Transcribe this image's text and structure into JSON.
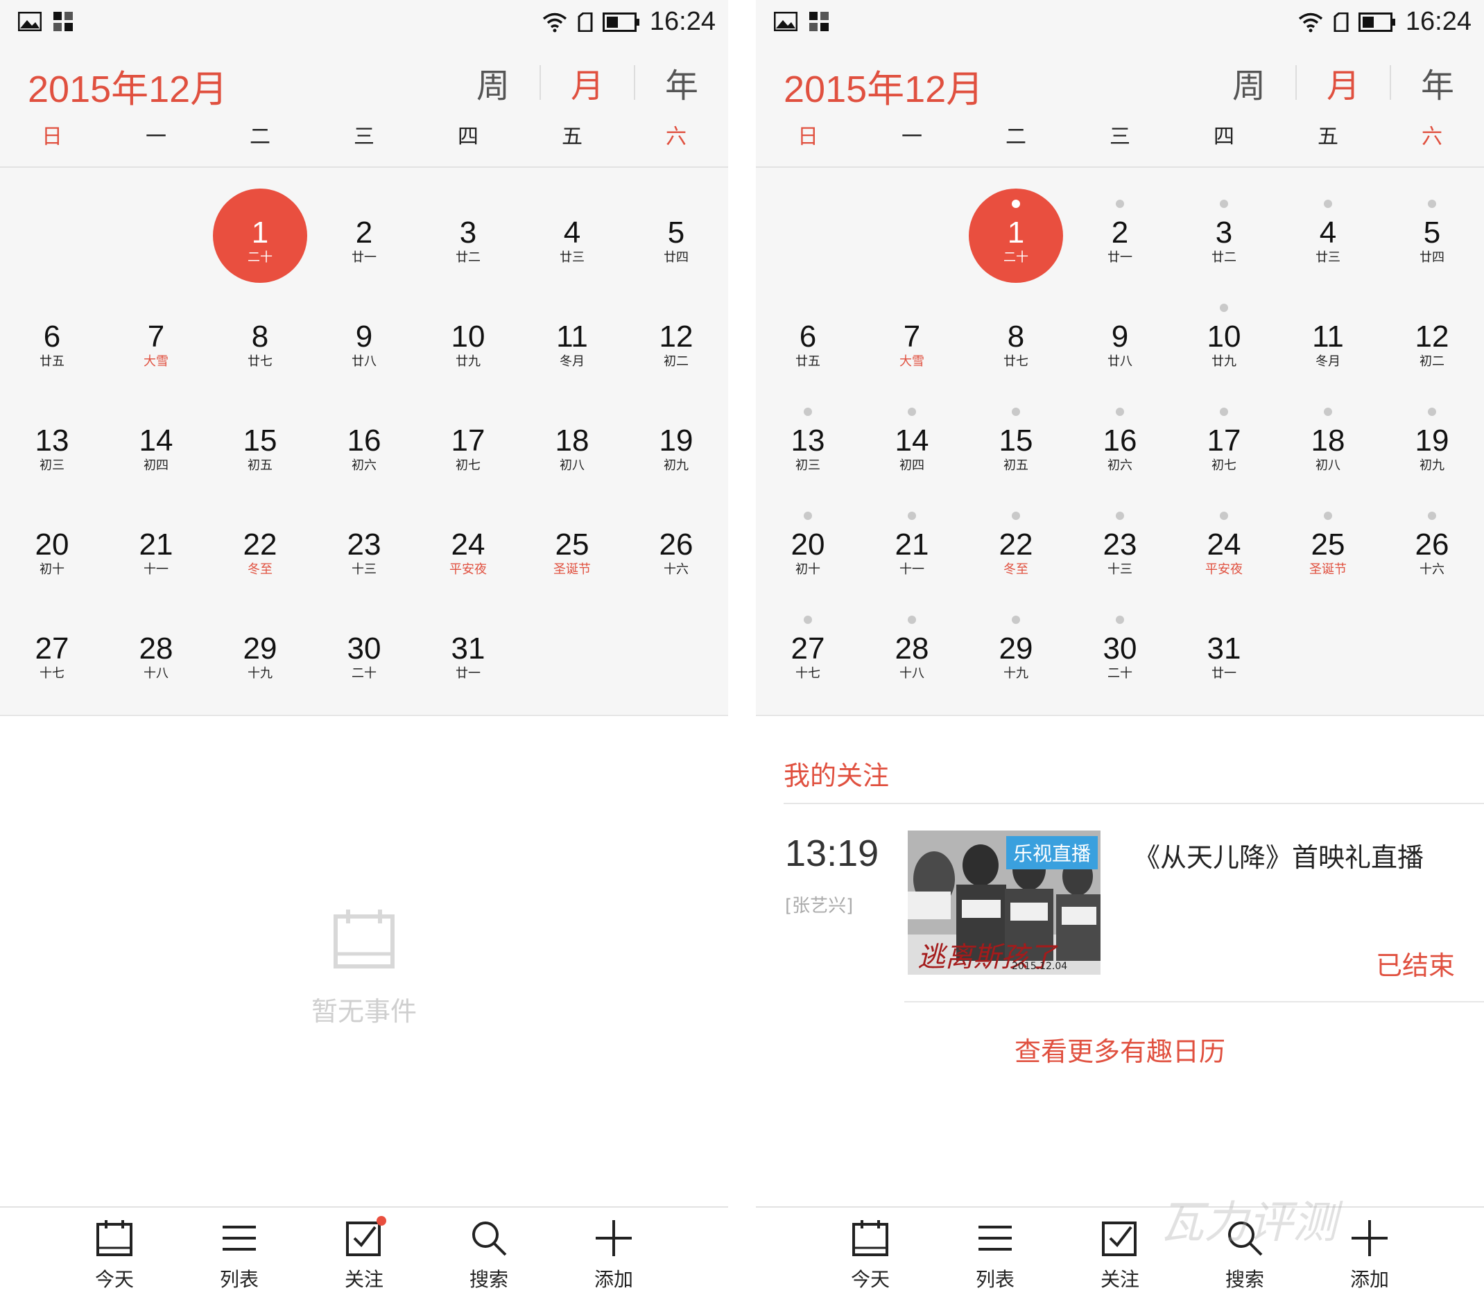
{
  "status_bar": {
    "time": "16:24"
  },
  "header": {
    "month_title": "2015年12月",
    "view_tabs": [
      {
        "label": "周",
        "active": false
      },
      {
        "label": "月",
        "active": true
      },
      {
        "label": "年",
        "active": false
      }
    ]
  },
  "weekdays": [
    "日",
    "一",
    "二",
    "三",
    "四",
    "五",
    "六"
  ],
  "calendar": {
    "days": [
      {
        "day": "1",
        "lunar": "二十",
        "selected": true,
        "lunar_red": false
      },
      {
        "day": "2",
        "lunar": "廿一",
        "lunar_red": false
      },
      {
        "day": "3",
        "lunar": "廿二",
        "lunar_red": false
      },
      {
        "day": "4",
        "lunar": "廿三",
        "lunar_red": false
      },
      {
        "day": "5",
        "lunar": "廿四",
        "lunar_red": false
      },
      {
        "day": "6",
        "lunar": "廿五",
        "lunar_red": false
      },
      {
        "day": "7",
        "lunar": "大雪",
        "lunar_red": true
      },
      {
        "day": "8",
        "lunar": "廿七",
        "lunar_red": false
      },
      {
        "day": "9",
        "lunar": "廿八",
        "lunar_red": false
      },
      {
        "day": "10",
        "lunar": "廿九",
        "lunar_red": false
      },
      {
        "day": "11",
        "lunar": "冬月",
        "lunar_red": false
      },
      {
        "day": "12",
        "lunar": "初二",
        "lunar_red": false
      },
      {
        "day": "13",
        "lunar": "初三",
        "lunar_red": false
      },
      {
        "day": "14",
        "lunar": "初四",
        "lunar_red": false
      },
      {
        "day": "15",
        "lunar": "初五",
        "lunar_red": false
      },
      {
        "day": "16",
        "lunar": "初六",
        "lunar_red": false
      },
      {
        "day": "17",
        "lunar": "初七",
        "lunar_red": false
      },
      {
        "day": "18",
        "lunar": "初八",
        "lunar_red": false
      },
      {
        "day": "19",
        "lunar": "初九",
        "lunar_red": false
      },
      {
        "day": "20",
        "lunar": "初十",
        "lunar_red": false
      },
      {
        "day": "21",
        "lunar": "十一",
        "lunar_red": false
      },
      {
        "day": "22",
        "lunar": "冬至",
        "lunar_red": true
      },
      {
        "day": "23",
        "lunar": "十三",
        "lunar_red": false
      },
      {
        "day": "24",
        "lunar": "平安夜",
        "lunar_red": true
      },
      {
        "day": "25",
        "lunar": "圣诞节",
        "lunar_red": true
      },
      {
        "day": "26",
        "lunar": "十六",
        "lunar_red": false
      },
      {
        "day": "27",
        "lunar": "十七",
        "lunar_red": false
      },
      {
        "day": "28",
        "lunar": "十八",
        "lunar_red": false
      },
      {
        "day": "29",
        "lunar": "十九",
        "lunar_red": false
      },
      {
        "day": "30",
        "lunar": "二十",
        "lunar_red": false
      },
      {
        "day": "31",
        "lunar": "廿一",
        "lunar_red": false
      }
    ],
    "right_event_dot_days": [
      1,
      2,
      3,
      4,
      5,
      10,
      13,
      14,
      15,
      16,
      17,
      18,
      19,
      20,
      21,
      22,
      23,
      24,
      25,
      26,
      27,
      28,
      29,
      30
    ]
  },
  "empty_state": {
    "text": "暂无事件",
    "icon": "calendar-empty-icon"
  },
  "follow": {
    "title": "我的关注",
    "event": {
      "time": "13:19",
      "tag": "[张艺兴]",
      "badge": "乐视直播",
      "thumb_caption": "逃离斯孩了",
      "thumb_date": "2015.12.04",
      "title": "《从天儿降》首映礼直播",
      "status": "已结束"
    },
    "more_link": "查看更多有趣日历"
  },
  "bottom_nav": [
    {
      "label": "今天",
      "icon": "calendar-today-icon"
    },
    {
      "label": "列表",
      "icon": "list-icon"
    },
    {
      "label": "关注",
      "icon": "follow-check-icon"
    },
    {
      "label": "搜索",
      "icon": "search-icon"
    },
    {
      "label": "添加",
      "icon": "add-icon"
    }
  ],
  "watermark": "瓦力评测",
  "colors": {
    "accent": "#e0503f",
    "selected_circle": "#e94f3f",
    "badge": "#3aa0de",
    "background": "#f6f6f6"
  }
}
